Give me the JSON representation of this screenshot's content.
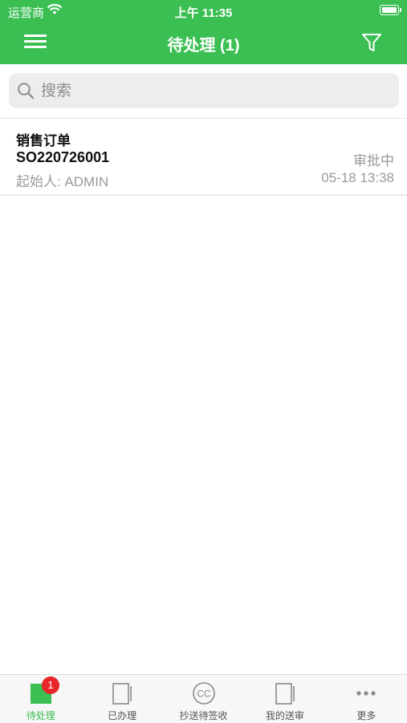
{
  "status_bar": {
    "carrier": "运营商",
    "time": "上午 11:35"
  },
  "navbar": {
    "title": "待处理 (1)"
  },
  "search": {
    "placeholder": "搜索"
  },
  "items": [
    {
      "type": "销售订单",
      "code": "SO220726001",
      "status": "审批中",
      "initiator": "起始人: ADMIN",
      "date": "05-18 13:38"
    }
  ],
  "tabbar": {
    "tabs": [
      {
        "label": "待处理",
        "icon": "pending-icon",
        "badge": "1",
        "active": true
      },
      {
        "label": "已办理",
        "icon": "done-icon"
      },
      {
        "label": "抄送待签收",
        "icon": "cc-icon"
      },
      {
        "label": "我的送审",
        "icon": "my-submissions-icon"
      },
      {
        "label": "更多",
        "icon": "more-icon"
      }
    ]
  },
  "colors": {
    "accent": "#3bbf53",
    "badge": "#e8262a"
  }
}
